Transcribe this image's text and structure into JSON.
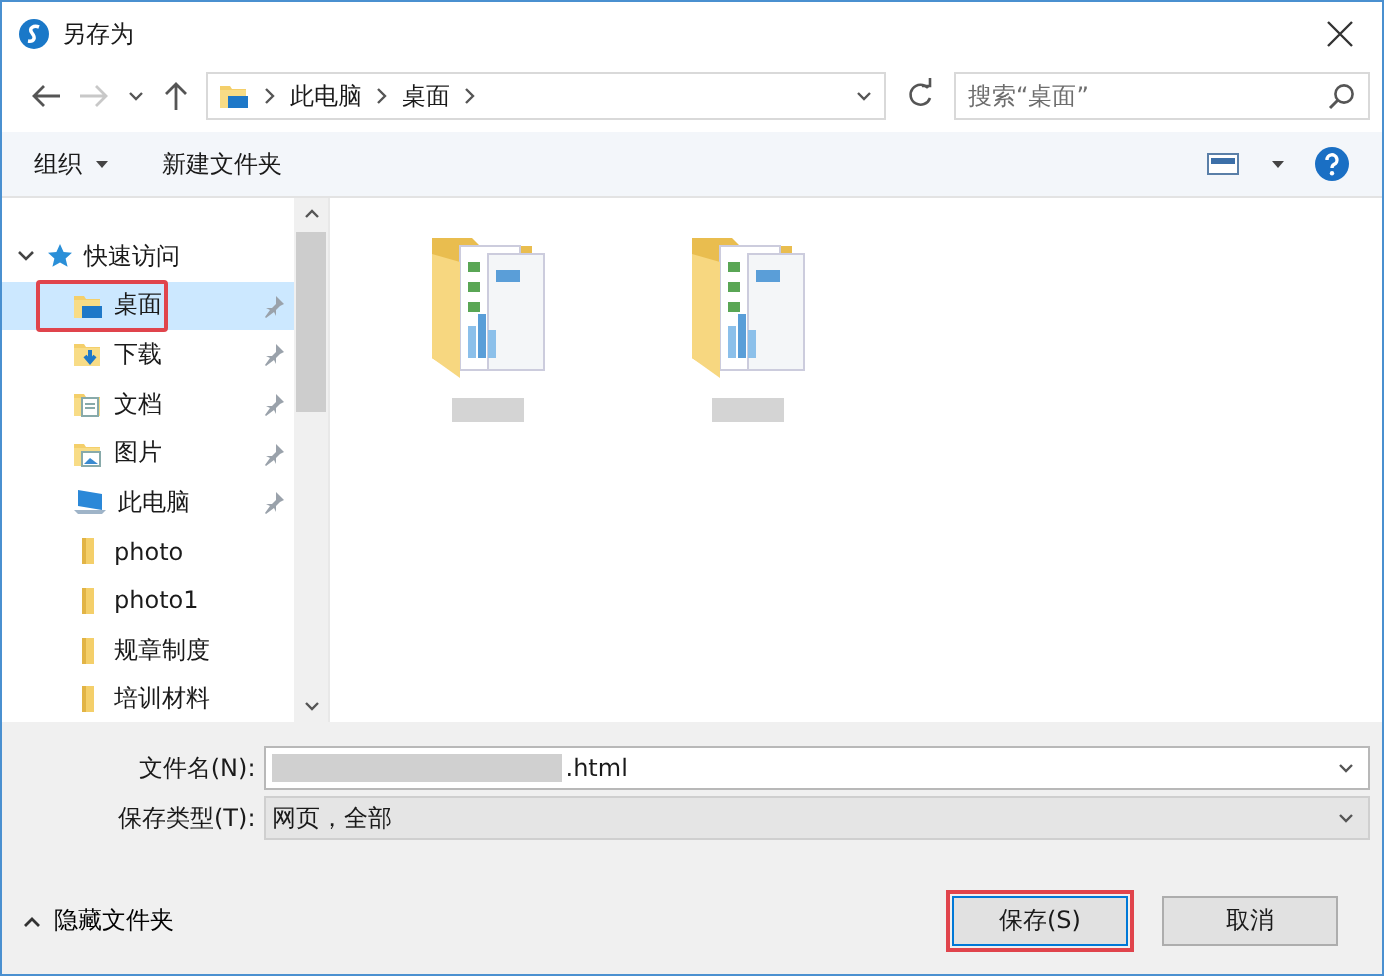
{
  "window": {
    "title": "另存为"
  },
  "nav": {
    "breadcrumb": [
      "此电脑",
      "桌面"
    ],
    "search": {
      "placeholder": "搜索“桌面”"
    }
  },
  "toolbar": {
    "buttons": [
      {
        "label": "组织",
        "dropdown": true
      },
      {
        "label": "新建文件夹",
        "dropdown": false
      }
    ]
  },
  "sidebar": {
    "items": [
      {
        "label": "快速访问",
        "kind": "star",
        "expanded": true,
        "selected": false,
        "children": [
          {
            "label": "桌面",
            "kind": "desktop",
            "pinned": true,
            "selected": true,
            "highlighted": true
          },
          {
            "label": "下载",
            "kind": "download",
            "pinned": true,
            "selected": false,
            "highlighted": false
          },
          {
            "label": "文档",
            "kind": "documents",
            "pinned": true,
            "selected": false,
            "highlighted": false
          },
          {
            "label": "图片",
            "kind": "pictures",
            "pinned": true,
            "selected": false,
            "highlighted": false
          },
          {
            "label": "此电脑",
            "kind": "computer",
            "pinned": true,
            "selected": false,
            "highlighted": false
          },
          {
            "label": "photo",
            "kind": "folder",
            "pinned": false,
            "selected": false,
            "highlighted": false
          },
          {
            "label": "photo1",
            "kind": "folder",
            "pinned": false,
            "selected": false,
            "highlighted": false
          },
          {
            "label": "规章制度",
            "kind": "folder",
            "pinned": false,
            "selected": false,
            "highlighted": false
          },
          {
            "label": "培训材料",
            "kind": "folder",
            "pinned": false,
            "selected": false,
            "highlighted": false
          }
        ]
      }
    ]
  },
  "files": [
    {
      "kind": "folder"
    },
    {
      "kind": "folder"
    }
  ],
  "form": {
    "filename": {
      "label": "文件名(N):",
      "value": ".html"
    },
    "filetype": {
      "label": "保存类型(T):",
      "value": "网页，全部"
    }
  },
  "footer": {
    "toggle": "隐藏文件夹",
    "buttons": [
      {
        "label": "保存(S)",
        "kind": "primary",
        "highlighted": true
      },
      {
        "label": "取消",
        "kind": "default",
        "highlighted": false
      }
    ]
  }
}
